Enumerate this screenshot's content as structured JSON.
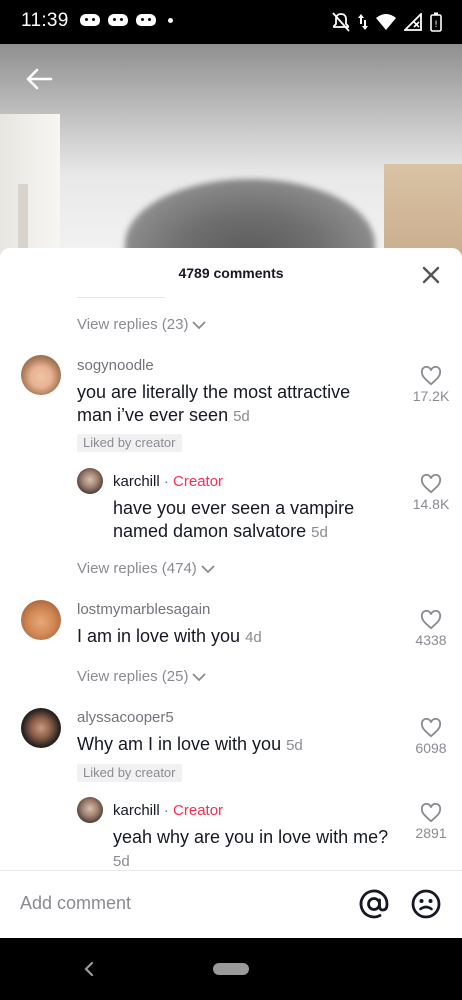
{
  "status_bar": {
    "time": "11:39"
  },
  "sheet": {
    "title": "4789 comments",
    "view_replies_top": "View replies (23)"
  },
  "comments": [
    {
      "username": "sogynoodle",
      "text_line1": "you are literally the most attractive",
      "text_line2": "man i’ve ever seen",
      "time": "5d",
      "badge": "Liked by creator",
      "likes": "17.2K",
      "reply": {
        "username": "karchill",
        "separator": "·",
        "creator_label": "Creator",
        "text_line1": "have you ever seen a vampire",
        "text_line2": "named damon salvatore",
        "time": "5d",
        "likes": "14.8K"
      },
      "view_replies": "View replies (474)"
    },
    {
      "username": "lostmymarblesagain",
      "text_line1": "I am in love with you",
      "time": "4d",
      "likes": "4338",
      "view_replies": "View replies (25)"
    },
    {
      "username": "alyssacooper5",
      "text_line1": "Why am I in love with you",
      "time": "5d",
      "badge": "Liked by creator",
      "likes": "6098",
      "reply": {
        "username": "karchill",
        "separator": "·",
        "creator_label": "Creator",
        "text_line1": "yeah why are you in love with me?",
        "time": "5d",
        "likes": "2891"
      }
    }
  ],
  "composer": {
    "placeholder": "Add comment"
  },
  "colors": {
    "accent": "#fe2c55",
    "muted": "#8a8b91",
    "text": "#161823"
  },
  "icons": [
    "back-arrow-icon",
    "close-icon",
    "heart-icon",
    "chevron-down-icon",
    "at-icon",
    "emoji-icon",
    "gamepad-icon",
    "mute-icon",
    "wifi-icon",
    "signal-icon",
    "battery-icon"
  ]
}
